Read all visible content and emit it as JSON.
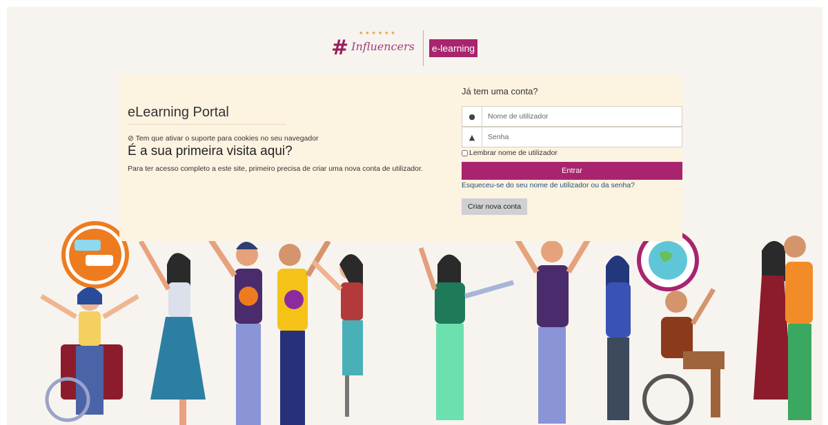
{
  "header": {
    "logo_text": "Influencers",
    "badge": "e-learning"
  },
  "left": {
    "title": "eLearning Portal",
    "cookie_note": "Tem que ativar o suporte para cookies no seu navegador",
    "first_visit_heading": "É a sua primeira visita aqui?",
    "intro": "Para ter acesso completo a este site, primeiro precisa de criar uma nova conta de utilizador."
  },
  "login": {
    "heading": "Já tem uma conta?",
    "username_placeholder": "Nome de utilizador",
    "password_placeholder": "Senha",
    "remember_label": "Lembrar nome de utilizador",
    "login_button": "Entrar",
    "forgot_link": "Esqueceu-se do seu nome de utilizador ou da senha?",
    "create_account_button": "Criar nova conta"
  },
  "colors": {
    "brand": "#a8246e",
    "card_bg": "#fdf3e1",
    "page_bg": "#f7f3ef"
  },
  "illustration": {
    "description_icon": "diverse-people-celebrating-illustration"
  }
}
